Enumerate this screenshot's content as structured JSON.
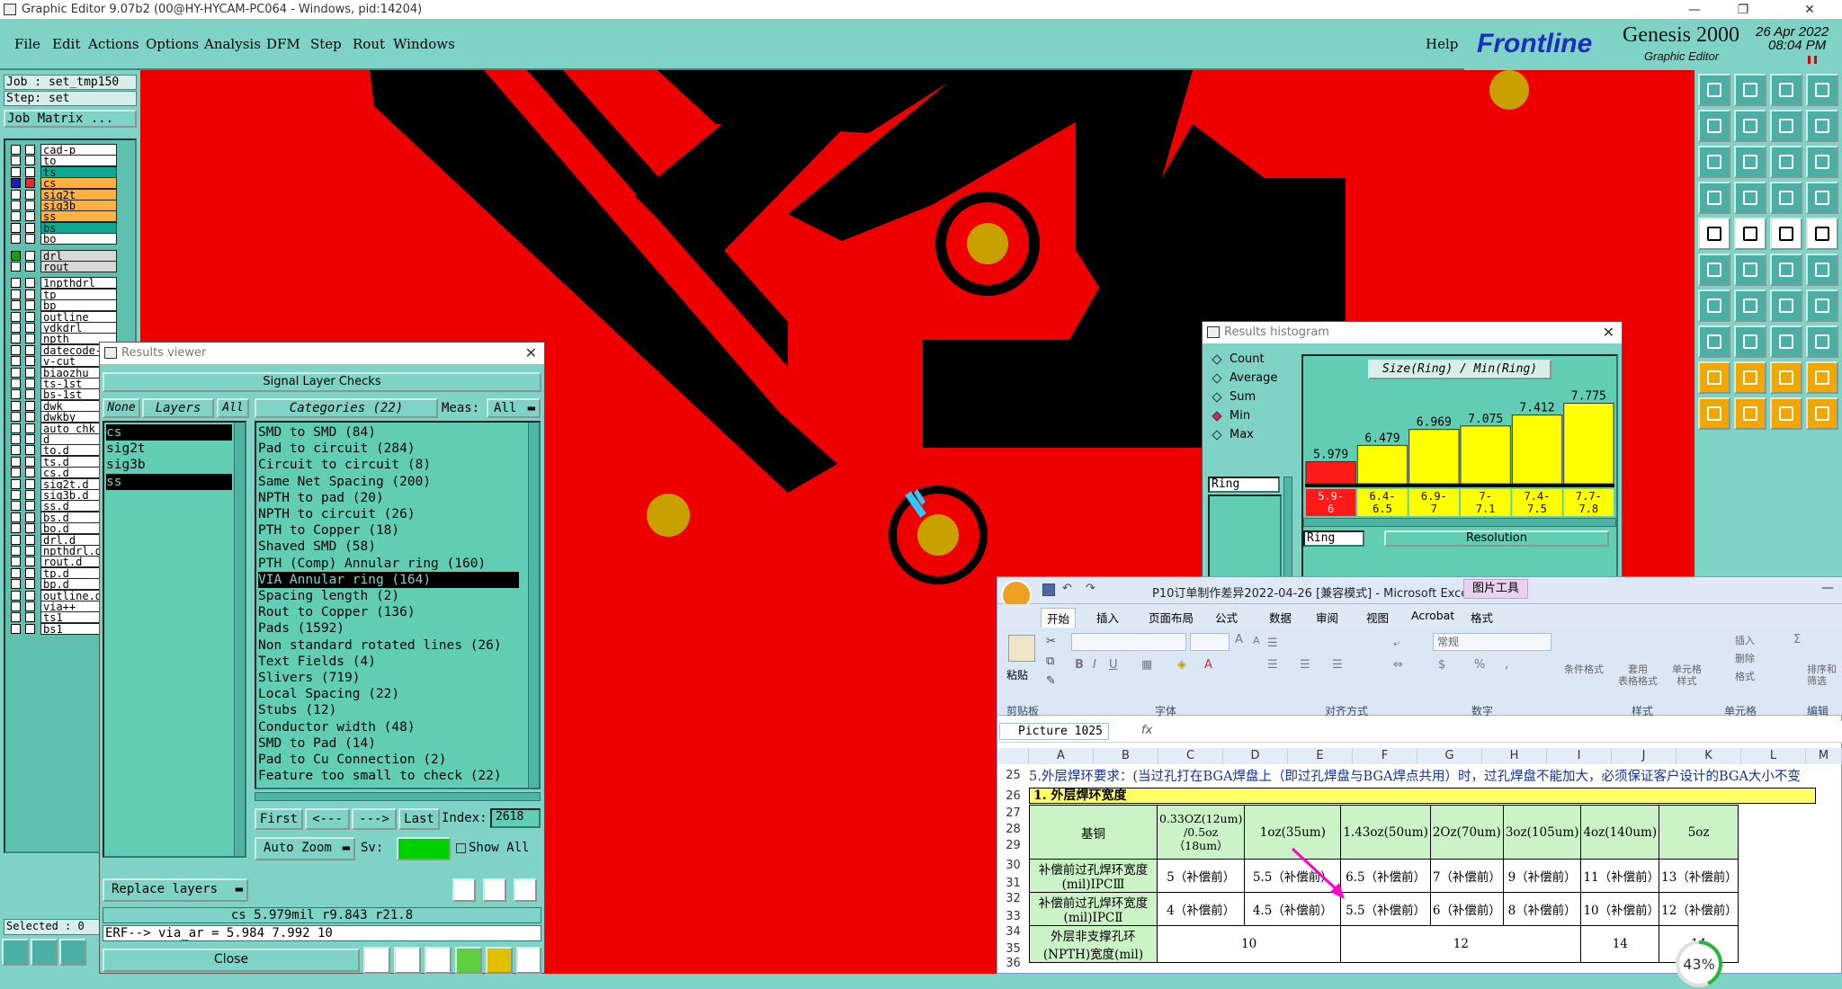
{
  "window": {
    "title": "Graphic Editor 9.07b2 (00@HY-HYCAM-PC064 - Windows, pid:14204)"
  },
  "menu": {
    "items": [
      "File",
      "Edit",
      "Actions",
      "Options",
      "Analysis",
      "DFM",
      "Step",
      "Rout",
      "Windows"
    ],
    "help": "Help"
  },
  "brand": {
    "logo": "Frontline",
    "product": "Genesis 2000",
    "subtitle": "Graphic Editor",
    "date": "26 Apr 2022",
    "time": "08:04 PM"
  },
  "job": {
    "job": "Job : set_tmp150",
    "step": "Step: set",
    "matrix": "Job Matrix ..."
  },
  "layers": [
    "cad-p",
    "to",
    "ts",
    "cs",
    "sig2t",
    "sig3b",
    "ss",
    "bs",
    "bo",
    "drl",
    "rout",
    "1npthdrl",
    "tp",
    "bp",
    "outline",
    "ydkdrl",
    "npth",
    "datecode-t",
    "v-cut",
    "biaozhu",
    "ts-1st",
    "bs-1st",
    "dwk",
    "dwkby",
    "auto_chk_p",
    "d",
    "to.d",
    "ts.d",
    "cs.d",
    "sig2t.d",
    "sig3b.d",
    "ss.d",
    "bs.d",
    "bo.d",
    "drl.d",
    "npthdrl.d",
    "rout.d",
    "tp.d",
    "bp.d",
    "outline.d",
    "via++",
    "ts1",
    "bs1"
  ],
  "selected_count": "Selected : 0",
  "results_viewer": {
    "title": "Results viewer",
    "heading": "Signal Layer Checks",
    "none": "None",
    "layers": "Layers",
    "all": "All",
    "categories_label": "Categories (22)",
    "meas_label": "Meas:",
    "meas_value": "All",
    "layer_list": [
      "cs",
      "sig2t",
      "sig3b",
      "ss"
    ],
    "categories": [
      "SMD to SMD (84)",
      "Pad to circuit (284)",
      "Circuit to circuit (8)",
      "Same Net Spacing (200)",
      "NPTH to pad (20)",
      "NPTH to circuit (26)",
      "PTH to Copper (18)",
      "Shaved SMD (58)",
      "PTH (Comp) Annular ring (160)",
      "VIA Annular ring (164)",
      "Spacing length (2)",
      "Rout to Copper (136)",
      "Pads (1592)",
      "Non standard rotated lines (26)",
      "Text Fields (4)",
      "Slivers (719)",
      "Local Spacing (22)",
      "Stubs (12)",
      "Conductor width (48)",
      "SMD to Pad (14)",
      "Pad to Cu Connection (2)",
      "Feature too small to check (22)"
    ],
    "selected_category": 9,
    "first": "First",
    "prev": "<---",
    "next": "--->",
    "last": "Last",
    "index_label": "Index:",
    "index_value": "2618",
    "zoom": "Auto Zoom",
    "sv_label": "Sv:",
    "show_all": "Show All",
    "replace_layers": "Replace layers",
    "status_line": "cs 5.979mil   r9.843   r21.8",
    "erf_line": "ERF--> via_ar = 5.984 7.992 10",
    "close": "Close"
  },
  "histogram": {
    "title": "Results histogram",
    "options": [
      "Count",
      "Average",
      "Sum",
      "Min",
      "Max"
    ],
    "selected_option": "Min",
    "chart_title": "Size(Ring) / Min(Ring)",
    "field": "Ring",
    "field2": "Ring",
    "resolution": "Resolution",
    "chart_data": {
      "type": "bar",
      "categories": [
        "5.9-6",
        "6.4-6.5",
        "6.9-7",
        "7-7.1",
        "7.4-7.5",
        "7.7-7.8"
      ],
      "values": [
        5.979,
        6.479,
        6.969,
        7.075,
        7.412,
        7.775
      ],
      "value_labels": [
        "5.979",
        "6.479",
        "6.969",
        "7.075",
        "7.412",
        "7.775"
      ],
      "colors": [
        "#ff1a1a",
        "#ffff00",
        "#ffff00",
        "#ffff00",
        "#ffff00",
        "#ffff00"
      ],
      "title": "Size(Ring) / Min(Ring)",
      "ylim": [
        5.3,
        7.9
      ]
    }
  },
  "excel": {
    "title": "P10订单制作差异2022-04-26  [兼容模式] - Microsoft Excel",
    "context_tab": "图片工具",
    "tabs": [
      "开始",
      "插入",
      "页面布局",
      "公式",
      "数据",
      "审阅",
      "视图",
      "Acrobat",
      "格式"
    ],
    "groups": [
      "剪贴板",
      "字体",
      "对齐方式",
      "数字",
      "样式",
      "单元格",
      "编辑"
    ],
    "paste": "粘贴",
    "number_format": "常规",
    "style_buttons": [
      "条件格式",
      "套用\n表格格式",
      "单元格\n样式"
    ],
    "cell_buttons": [
      "插入",
      "删除",
      "格式"
    ],
    "edit_buttons": [
      "排序和\n筛选"
    ],
    "name_box": "Picture 1025",
    "fx": "fx",
    "columns": [
      "A",
      "B",
      "C",
      "D",
      "E",
      "F",
      "G",
      "H",
      "I",
      "J",
      "K",
      "L",
      "M"
    ],
    "rows": [
      "25",
      "26",
      "27",
      "28",
      "29",
      "30",
      "31",
      "32",
      "33",
      "34",
      "35",
      "36"
    ],
    "row25_text": "5.外层焊环要求：(当过孔打在BGA焊盘上（即过孔焊盘与BGA焊点共用）时，过孔焊盘不能加大，必须保证客户设计的BGA大小不变",
    "row26_text": "1. 外层焊环宽度",
    "header_row": {
      "label": "基铜",
      "cols": [
        "0.33OZ(12um)\n/0.5oz\n（18um）",
        "1oz(35um)",
        "1.43oz(50um)",
        "2Oz(70um)",
        "3oz(105um)",
        "4oz(140um)",
        "5oz"
      ]
    },
    "row_ipc3": {
      "label": "补偿前过孔焊环宽度(mil)IPCⅢ",
      "cols": [
        "5（补偿前）",
        "5.5（补偿前）",
        "6.5（补偿前）",
        "7（补偿前）",
        "9（补偿前）",
        "11（补偿前）",
        "13（补偿前）"
      ]
    },
    "row_ipc2": {
      "label": "补偿前过孔焊环宽度(mil)IPCⅡ",
      "cols": [
        "4（补偿前）",
        "4.5（补偿前）",
        "5.5（补偿前）",
        "6（补偿前）",
        "8（补偿前）",
        "10（补偿前）",
        "12（补偿前）"
      ]
    },
    "row_npth": {
      "label": "外层非支撑孔环(NPTH)宽度(mil)",
      "cols": [
        "10",
        "12",
        "14",
        "14"
      ]
    },
    "progress": "43%",
    "progress_value": 0.43
  }
}
